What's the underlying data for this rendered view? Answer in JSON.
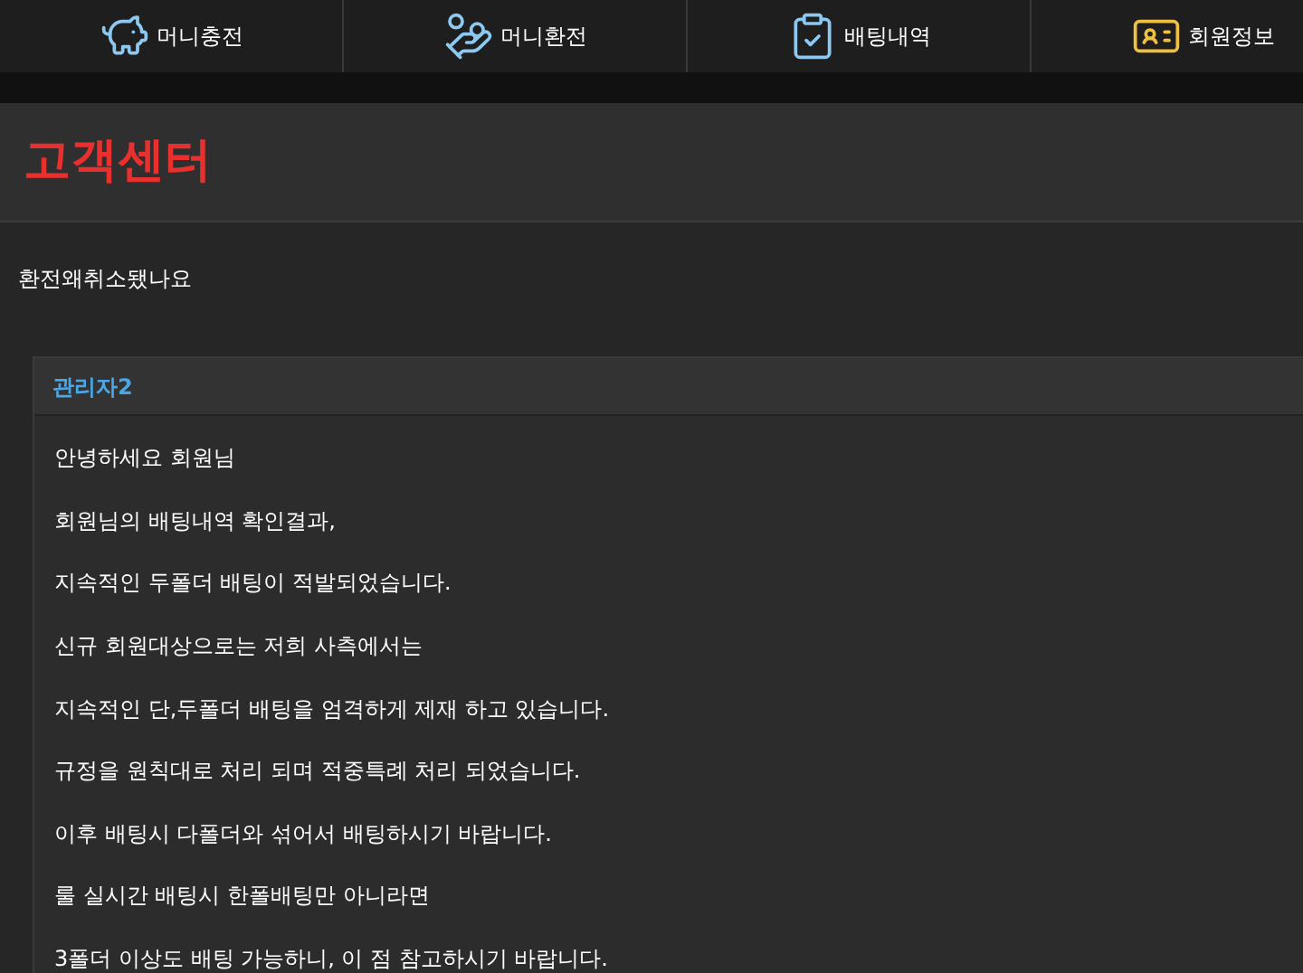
{
  "nav": {
    "items": [
      {
        "kind": "deposit",
        "label": "머니충전"
      },
      {
        "kind": "withdraw",
        "label": "머니환전"
      },
      {
        "kind": "history",
        "label": "배팅내역"
      },
      {
        "kind": "profile",
        "label": "회원정보"
      }
    ]
  },
  "page_title": "고객센터",
  "question": "환전왜취소됐나요",
  "answer": {
    "author": "관리자2",
    "lines": [
      "안녕하세요 회원님",
      "회원님의 배팅내역 확인결과,",
      "지속적인 두폴더 배팅이 적발되었습니다.",
      "신규 회원대상으로는 저희 사측에서는",
      "지속적인 단,두폴더 배팅을 엄격하게 제재 하고 있습니다.",
      "규정을 원칙대로 처리 되며 적중특례 처리 되었습니다.",
      "이후 배팅시 다폴더와 섞어서 배팅하시기 바랍니다.",
      "룰 실시간 배팅시 한폴배팅만 아니라면",
      "3폴더 이상도 배팅 가능하니, 이 점 참고하시기 바랍니다."
    ]
  }
}
